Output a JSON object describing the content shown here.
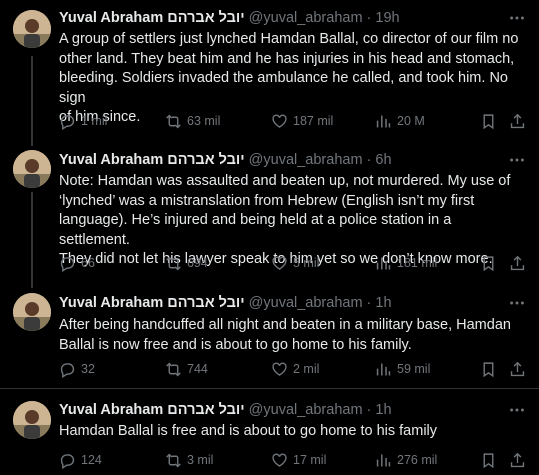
{
  "author": {
    "name": "Yuval Abraham יובל אברהם",
    "handle": "@yuval_abraham"
  },
  "tweets": [
    {
      "time": "19h",
      "text": "A group of settlers just lynched Hamdan Ballal, co director of our film no\nother land. They beat him and he has injuries in his head and stomach,\nbleeding. Soldiers invaded the ambulance he called, and took him. No sign\nof him since.",
      "replies": "1 mil",
      "reposts": "63 mil",
      "likes": "187 mil",
      "views": "20 M"
    },
    {
      "time": "6h",
      "text": "Note: Hamdan was assaulted and beaten up, not murdered. My use of\n‘lynched’ was a mistranslation from Hebrew (English isn’t my first\nlanguage). He’s injured and being held at a police station in a settlement.\nThey did not let his lawyer speak to him yet so we don’t know more.",
      "replies": "66",
      "reposts": "694",
      "likes": "5 mil",
      "views": "181 mil"
    },
    {
      "time": "1h",
      "text": "After being handcuffed all night and beaten in a military base, Hamdan\nBallal is now free and is about to go home to his family.",
      "replies": "32",
      "reposts": "744",
      "likes": "2 mil",
      "views": "59 mil"
    },
    {
      "time": "1h",
      "text": "Hamdan Ballal is free and is about to go home to his family",
      "replies": "124",
      "reposts": "3 mil",
      "likes": "17 mil",
      "views": "276 mil"
    }
  ],
  "colors": {
    "background": "#000000",
    "text": "#e7e9ea",
    "muted": "#71767b",
    "divider": "#2f3336"
  },
  "icons": [
    "more-icon",
    "reply-icon",
    "repost-icon",
    "like-icon",
    "views-icon",
    "bookmark-icon",
    "share-icon"
  ]
}
